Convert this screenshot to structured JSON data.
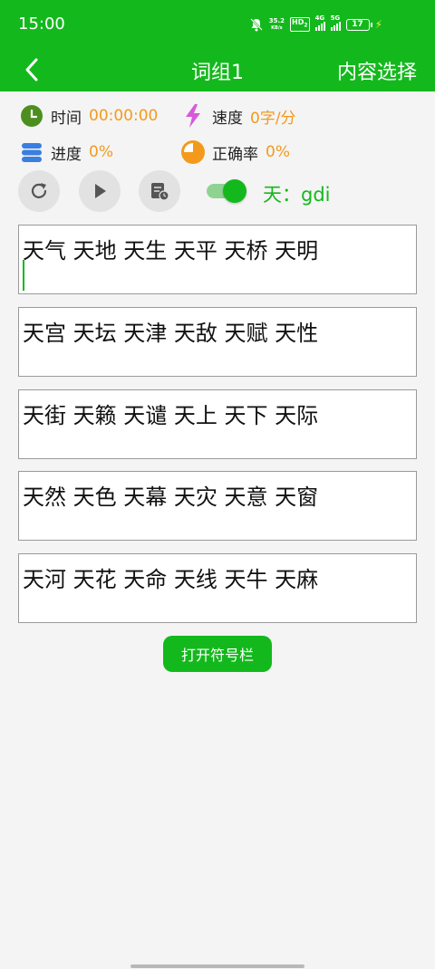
{
  "status_bar": {
    "time": "15:00",
    "net_speed_value": "35.2",
    "net_speed_unit": "KB/s",
    "hd_label": "HD",
    "hd_sub": "2",
    "signal1_label": "4G",
    "signal2_label": "5G",
    "battery": "17"
  },
  "header": {
    "title": "词组1",
    "content_select": "内容选择"
  },
  "stats": {
    "time_label": "时间",
    "time_value": "00:00:00",
    "speed_label": "速度",
    "speed_value": "0字/分",
    "progress_label": "进度",
    "progress_value": "0%",
    "accuracy_label": "正确率",
    "accuracy_value": "0%"
  },
  "controls": {
    "toggle_on": true,
    "code_hint": "天：gdi"
  },
  "word_boxes": [
    "天气 天地 天生 天平 天桥 天明",
    "天宫 天坛 天津 天敌 天赋 天性",
    "天街 天籁 天谴 天上 天下 天际",
    "天然 天色 天幕 天灾 天意 天窗",
    "天河 天花 天命 天线 天牛 天麻"
  ],
  "symbol_bar_button": "打开符号栏",
  "colors": {
    "brand_green": "#13b91c",
    "value_orange": "#f39a1c"
  },
  "icons": {
    "time": "clock-icon",
    "speed": "lightning-icon",
    "progress": "stack-icon",
    "accuracy": "pie-chart-icon",
    "reset": "refresh-icon",
    "play": "play-icon",
    "history": "record-icon"
  }
}
